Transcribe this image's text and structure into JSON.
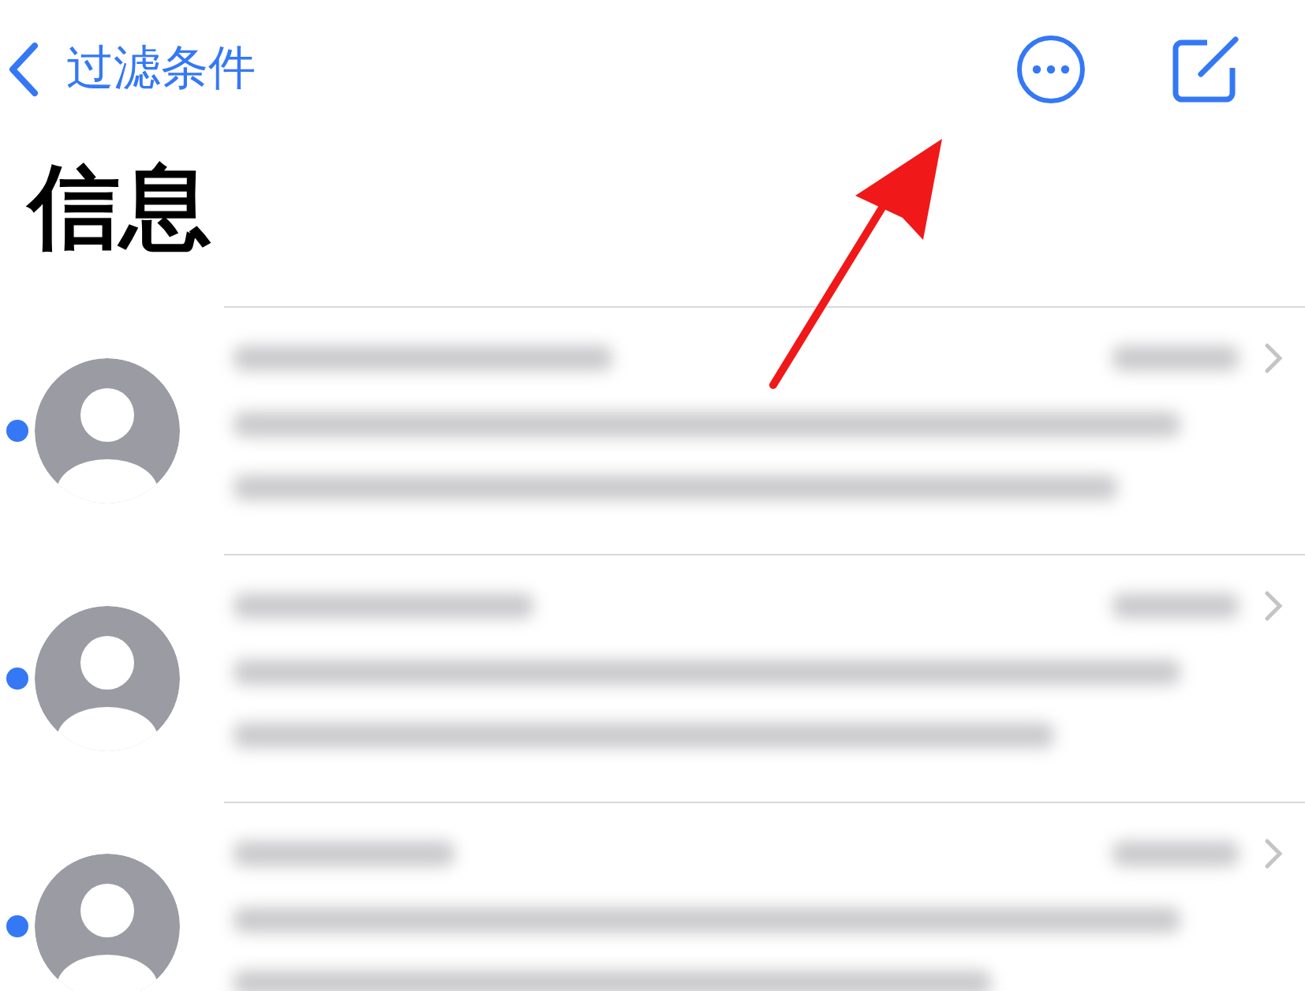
{
  "nav": {
    "back_label": "过滤条件"
  },
  "title": "信息",
  "conversations": [
    {
      "unread": true
    },
    {
      "unread": true
    },
    {
      "unread": true
    }
  ]
}
